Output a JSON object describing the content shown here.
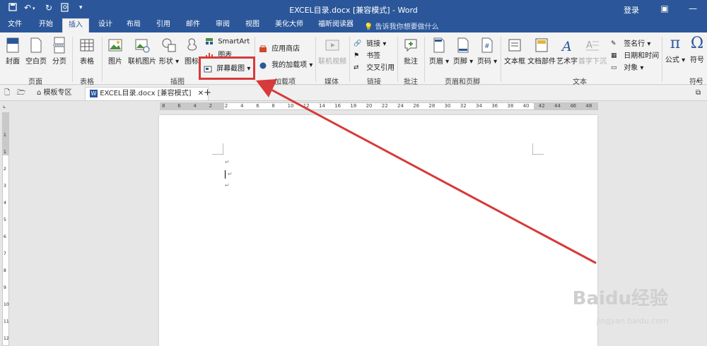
{
  "titlebar": {
    "doc_title": "EXCEL目录.docx [兼容模式] - Word",
    "login": "登录",
    "quick_access": [
      "save-icon",
      "undo-icon",
      "redo-icon",
      "print-preview-icon",
      "customize-icon"
    ]
  },
  "tabs": [
    "文件",
    "开始",
    "插入",
    "设计",
    "布局",
    "引用",
    "邮件",
    "审阅",
    "视图",
    "美化大师",
    "福昕阅读器"
  ],
  "active_tab": "插入",
  "tell_me": "告诉我你想要做什么",
  "ribbon": {
    "pages": {
      "cover": "封面",
      "blank": "空白页",
      "break": "分页",
      "group": "页面"
    },
    "tables": {
      "table": "表格",
      "group": "表格"
    },
    "illustrations": {
      "picture": "图片",
      "online_picture": "联机图片",
      "shapes": "形状",
      "icons": "图标",
      "smartart": "SmartArt",
      "chart": "图表",
      "screenshot": "屏幕截图",
      "group": "插图"
    },
    "addins": {
      "store": "应用商店",
      "my_addins": "我的加载项",
      "group": "加载项"
    },
    "media": {
      "online_video": "联机视频",
      "group": "媒体"
    },
    "links": {
      "link": "链接",
      "bookmark": "书签",
      "cross_ref": "交叉引用",
      "group": "链接"
    },
    "comments": {
      "comment": "批注",
      "group": "批注"
    },
    "header_footer": {
      "header": "页眉",
      "footer": "页脚",
      "page_num": "页码",
      "group": "页眉和页脚"
    },
    "text": {
      "textbox": "文本框",
      "doc_parts": "文档部件",
      "wordart": "艺术字",
      "dropcap": "首字下沉",
      "signature": "签名行",
      "datetime": "日期和时间",
      "object": "对象",
      "group": "文本"
    },
    "symbols": {
      "equation": "公式",
      "symbol": "符号",
      "group": "符号"
    }
  },
  "doc_tabs": {
    "templates": "模板专区",
    "current": "EXCEL目录.docx [兼容模式]"
  },
  "ruler_ticks": [
    "8",
    "6",
    "4",
    "2",
    "2",
    "4",
    "6",
    "8",
    "10",
    "12",
    "14",
    "16",
    "18",
    "20",
    "22",
    "24",
    "26",
    "28",
    "30",
    "32",
    "34",
    "36",
    "38",
    "40",
    "42",
    "44",
    "46",
    "48"
  ],
  "vruler_ticks": [
    "1",
    "1",
    "2",
    "3",
    "4",
    "5",
    "6",
    "7",
    "8",
    "9",
    "10",
    "11",
    "12"
  ],
  "paragraph_mark": "↵",
  "watermark": {
    "brand": "Baidu经验",
    "url": "jingyan.baidu.com"
  },
  "colors": {
    "accent": "#2b579a",
    "annotation": "#d73a3a"
  }
}
